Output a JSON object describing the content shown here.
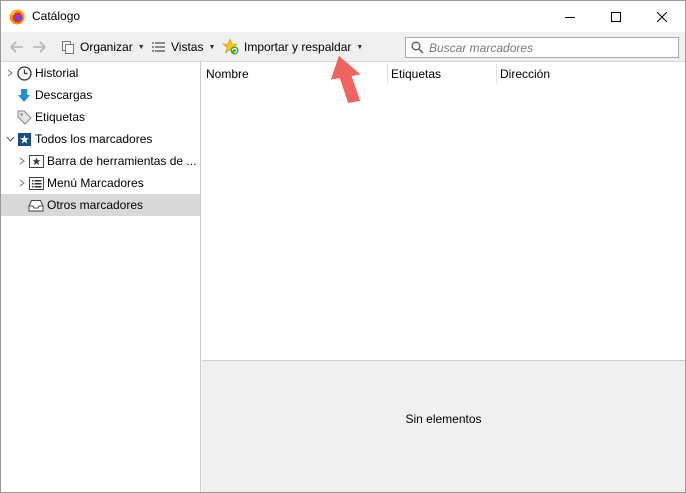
{
  "window": {
    "title": "Catálogo",
    "icon": "firefox-icon"
  },
  "toolbar": {
    "organize_label": "Organizar",
    "views_label": "Vistas",
    "import_label": "Importar y respaldar",
    "search_placeholder": "Buscar marcadores"
  },
  "sidebar": {
    "items": [
      {
        "label": "Historial",
        "icon": "clock-icon"
      },
      {
        "label": "Descargas",
        "icon": "download-arrow-icon"
      },
      {
        "label": "Etiquetas",
        "icon": "tag-icon"
      },
      {
        "label": "Todos los marcadores",
        "icon": "bookmarks-star-icon"
      },
      {
        "label": "Barra de herramientas de ...",
        "icon": "toolbar-bookmark-icon"
      },
      {
        "label": "Menú Marcadores",
        "icon": "menu-list-icon"
      },
      {
        "label": "Otros marcadores",
        "icon": "tray-icon"
      }
    ]
  },
  "columns": [
    "Nombre",
    "Etiquetas",
    "Dirección"
  ],
  "details": {
    "empty_text": "Sin elementos"
  },
  "colors": {
    "selection": "#d9d9d9",
    "toolbar_bg": "#f0f0f0",
    "annotation_arrow": "#f0635f"
  }
}
